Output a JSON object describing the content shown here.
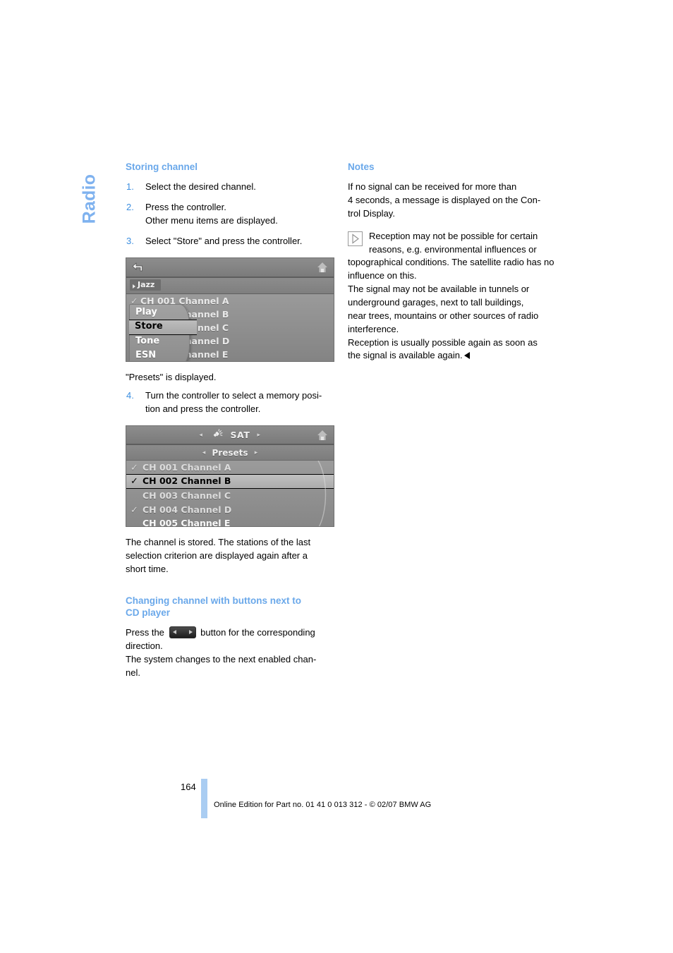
{
  "chapter": {
    "title": "Radio"
  },
  "left_column": {
    "heading": "Storing channel",
    "steps": [
      {
        "num": "1.",
        "lines": [
          "Select the desired channel."
        ]
      },
      {
        "num": "2.",
        "lines": [
          "Press the controller.",
          "Other menu items are displayed."
        ]
      },
      {
        "num": "3.",
        "lines": [
          "Select \"Store\" and press the controller."
        ]
      }
    ],
    "after_first_figure": "\"Presets\" is displayed.",
    "step4": {
      "num": "4.",
      "lines": [
        "Turn the controller to select a memory posi-",
        "tion and press the controller."
      ]
    },
    "after_second_figure": [
      "The channel is stored. The stations of the last",
      "selection criterion are displayed again after a",
      "short time."
    ],
    "heading2_line1": "Changing channel with buttons next to",
    "heading2_line2": "CD player",
    "cd_text_before": "Press the",
    "cd_text_after": "button for the corresponding",
    "cd_lines": [
      "direction.",
      "The system changes to the next enabled chan-",
      "nel."
    ]
  },
  "right_column": {
    "heading": "Notes",
    "intro": [
      "If no signal can be received for more than",
      "4 seconds, a message is displayed on the Con-",
      "trol Display."
    ],
    "note_body": "Reception may not be possible for certain reasons, e.g. environmental influences or topographical conditions. The satellite radio has no influence on this.",
    "note_continued": [
      "The signal may not be available in tunnels or",
      "underground garages, next to tall buildings,",
      "near trees, mountains or other sources of radio",
      "interference.",
      "Reception is usually possible again as soon as",
      "the signal is available again."
    ]
  },
  "figure1": {
    "back_icon": "back-arrow-icon",
    "home_icon": "home-icon",
    "category_tag": "Jazz",
    "background_rows": [
      {
        "check": "✓",
        "label": "CH 001 Channel A"
      },
      {
        "check": "",
        "label": "CH 002 Channel B"
      },
      {
        "check": "",
        "label": "CH 003 Channel C"
      },
      {
        "check": "",
        "label": "CH 004 Channel D"
      },
      {
        "check": "",
        "label": "CH 005 Channel E"
      }
    ],
    "menu_items": [
      {
        "label": "Play",
        "selected": false
      },
      {
        "label": "Store",
        "selected": true
      },
      {
        "label": "Tone",
        "selected": false
      },
      {
        "label": "ESN",
        "selected": false
      }
    ]
  },
  "figure2": {
    "source_label": "SAT",
    "sat_icon": "satellite-icon",
    "home_icon": "home-icon",
    "submenu_label": "Presets",
    "left_arrow": "◂",
    "right_arrow": "▸",
    "rows": [
      {
        "check": "✓",
        "label": "CH 001 Channel A",
        "selected": false,
        "dim": true
      },
      {
        "check": "✓",
        "label": "CH 002 Channel B",
        "selected": true,
        "dim": false
      },
      {
        "check": "",
        "label": "CH 003 Channel C",
        "selected": false,
        "dim": true
      },
      {
        "check": "✓",
        "label": "CH 004 Channel D",
        "selected": false,
        "dim": true
      },
      {
        "check": "",
        "label": "CH 005 Channel E",
        "selected": false,
        "dim": false
      }
    ]
  },
  "footer": {
    "page_number": "164",
    "imprint": "Online Edition for Part no. 01 41 0 013 312 - © 02/07 BMW AG"
  },
  "colors": {
    "accent_blue": "#6aa8ea",
    "tab_blue": "#7fb2ef",
    "step_number_blue": "#3d8fe0",
    "footer_bar_blue": "#aacdf2"
  }
}
